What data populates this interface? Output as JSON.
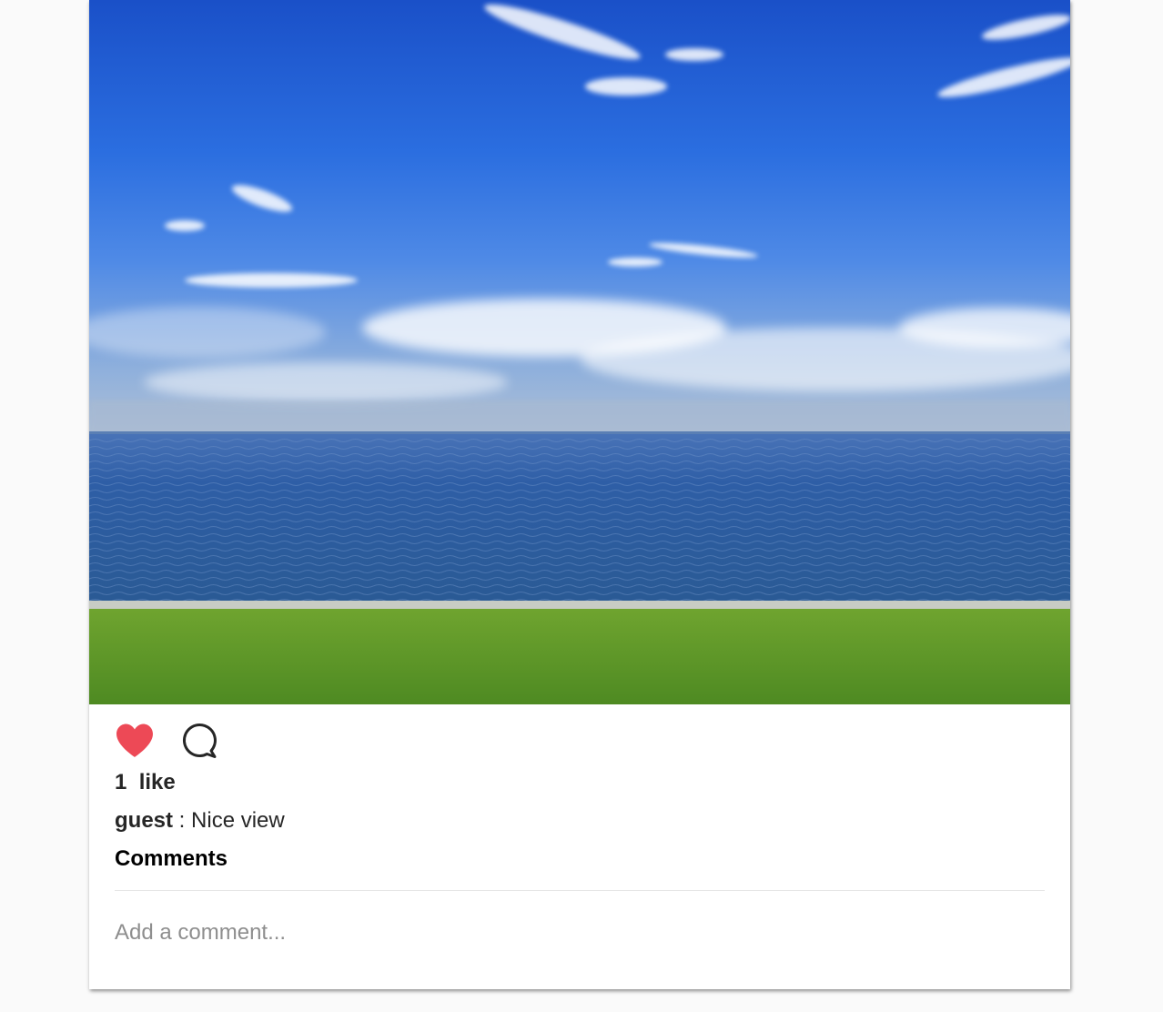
{
  "post": {
    "like_count": "1",
    "like_word": "like",
    "caption_user": "guest",
    "caption_separator": " : ",
    "caption_text": "Nice view"
  },
  "comments": {
    "heading": "Comments",
    "input_placeholder": "Add a comment...",
    "input_value": ""
  },
  "icons": {
    "like": "heart-icon",
    "comment": "speech-bubble-icon"
  },
  "colors": {
    "liked_heart": "#ed4956",
    "text": "#262626",
    "placeholder": "#8e8e8e"
  }
}
